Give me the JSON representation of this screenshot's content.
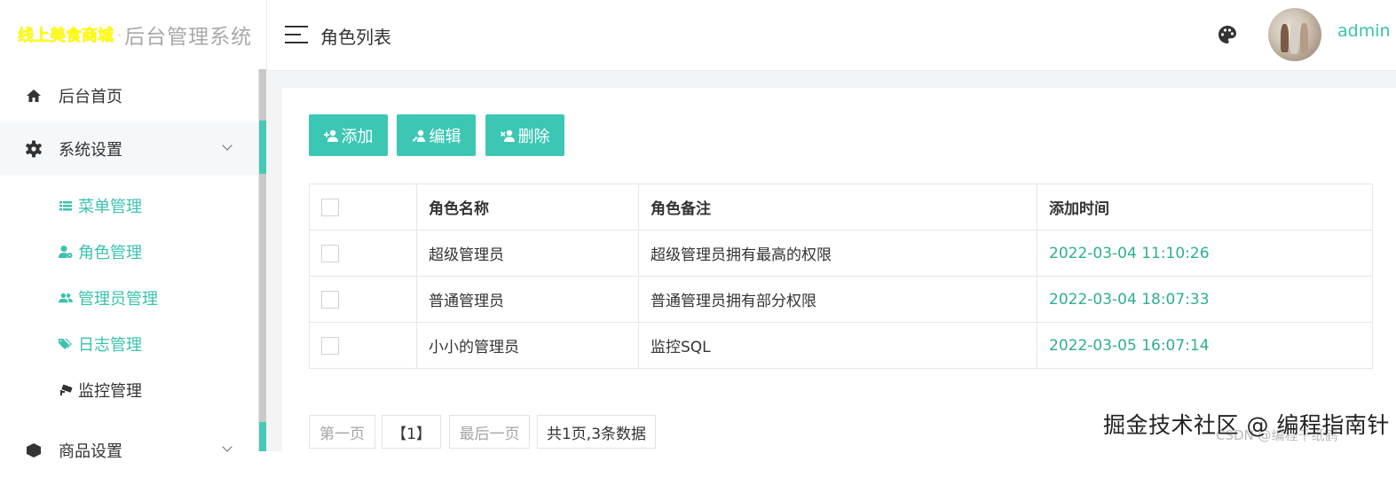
{
  "brand": {
    "main": "线上美食商城",
    "separator": "·",
    "sub": "后台管理系统"
  },
  "header": {
    "page_title": "角色列表",
    "user_name": "admin"
  },
  "icons": {
    "menu": "hamburger-icon",
    "theme": "palette-icon",
    "home": "home-icon",
    "settings": "gear-icon",
    "menu_manage": "list-icon",
    "role": "user-gear-icon",
    "admins": "users-icon",
    "log": "tags-icon",
    "monitor": "cctv-icon"
  },
  "sidebar": {
    "home": "后台首页",
    "system_settings": "系统设置",
    "sub_items": [
      "菜单管理",
      "角色管理",
      "管理员管理",
      "日志管理",
      "监控管理"
    ],
    "product_settings": "商品设置"
  },
  "toolbar": {
    "add": "添加",
    "edit": "编辑",
    "delete": "删除"
  },
  "table": {
    "headers": [
      "角色名称",
      "角色备注",
      "添加时间"
    ],
    "rows": [
      [
        "超级管理员",
        "超级管理员拥有最高的权限",
        "2022-03-04 11:10:26"
      ],
      [
        "普通管理员",
        "普通管理员拥有部分权限",
        "2022-03-04 18:07:33"
      ],
      [
        "小小的管理员",
        "监控SQL",
        "2022-03-05 16:07:14"
      ]
    ]
  },
  "pagination": {
    "first": "第一页",
    "current": "【1】",
    "last": "最后一页",
    "info": "共1页,3条数据"
  },
  "watermark": {
    "main": "掘金技术社区 @ 编程指南针",
    "sub": "CSDN @编程千纸鹤"
  },
  "colors": {
    "accent": "#3cc7b4",
    "time_text": "#2eae92",
    "brand": "#ffff00"
  }
}
